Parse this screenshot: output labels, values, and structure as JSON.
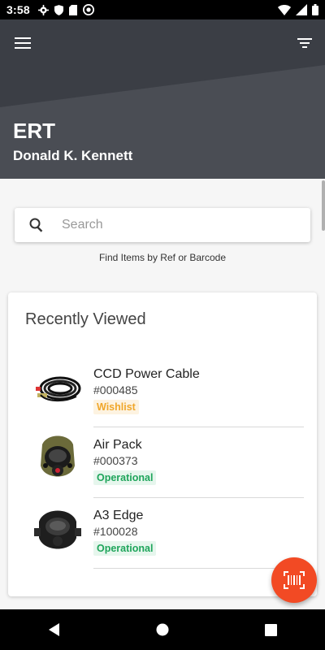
{
  "status_bar": {
    "time": "3:58",
    "icons": [
      "gear-icon",
      "shield-icon",
      "sd-card-icon",
      "sync-icon",
      "wifi-icon",
      "signal-icon",
      "battery-icon"
    ]
  },
  "header": {
    "title": "ERT",
    "user_name": "Donald K. Kennett",
    "menu_icon": "hamburger-menu-icon",
    "filter_icon": "filter-icon",
    "background_color": "#3a3d44"
  },
  "search": {
    "placeholder": "Search",
    "value": "",
    "hint": "Find Items by Ref or Barcode"
  },
  "recently_viewed": {
    "title": "Recently Viewed",
    "items": [
      {
        "name": "CCD Power Cable",
        "ref": "#000485",
        "status": "Wishlist",
        "thumb_icon": "power-cable-image"
      },
      {
        "name": "Air Pack",
        "ref": "#000373",
        "status": "Operational",
        "thumb_icon": "air-pack-mask-image"
      },
      {
        "name": "A3 Edge",
        "ref": "#100028",
        "status": "Operational",
        "thumb_icon": "helmet-mask-image"
      }
    ]
  },
  "fab": {
    "icon": "barcode-scan-icon",
    "color": "#f24a24"
  },
  "nav_bar": {
    "buttons": [
      "back-icon",
      "home-icon",
      "recents-icon"
    ]
  },
  "colors": {
    "wishlist": "#f0a72b",
    "operational": "#1fa55b"
  }
}
